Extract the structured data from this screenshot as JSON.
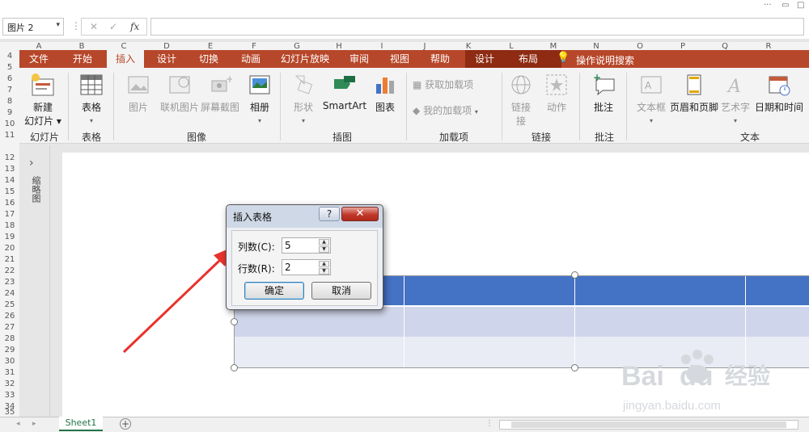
{
  "window": {
    "controls": [
      "···",
      "▭",
      "□"
    ]
  },
  "formula_bar": {
    "name_box": "图片 2",
    "cancel_icon": "✕",
    "enter_icon": "✓",
    "function_icon": "fx",
    "value": ""
  },
  "columns": [
    "A",
    "B",
    "C",
    "D",
    "E",
    "F",
    "G",
    "H",
    "I",
    "J",
    "K",
    "L",
    "M",
    "N",
    "O",
    "P",
    "Q",
    "R"
  ],
  "rows": [
    "4",
    "5",
    "6",
    "7",
    "8",
    "9",
    "10",
    "11",
    "12",
    "13",
    "14",
    "15",
    "16",
    "17",
    "18",
    "19",
    "20",
    "21",
    "22",
    "23",
    "24",
    "25",
    "26",
    "27",
    "28",
    "29",
    "30",
    "31",
    "32",
    "33",
    "34",
    "35"
  ],
  "ribbon_tabs": [
    "文件",
    "开始",
    "插入",
    "设计",
    "切换",
    "动画",
    "幻灯片放映",
    "审阅",
    "视图",
    "帮助",
    "设计",
    "布局"
  ],
  "active_tab": "插入",
  "tell_me": "操作说明搜索",
  "ribbon": {
    "new_slide": [
      "新建",
      "幻灯片 ▾"
    ],
    "table": "表格",
    "picture": "图片",
    "online_picture": "联机图片",
    "screenshot": "屏幕截图",
    "album": "相册",
    "shape": "形状",
    "smartart": "SmartArt",
    "chart": "图表",
    "get_addins": "获取加载项",
    "my_addins": "我的加载项",
    "link": "链接",
    "link_suffix": "接",
    "action": "动作",
    "comment": "批注",
    "textbox": "文本框",
    "header_footer": "页眉和页脚",
    "wordart": "艺术字",
    "datetime": "日期和时间",
    "groups": [
      "幻灯片",
      "表格",
      "图像",
      "插图",
      "加载项",
      "链接",
      "批注",
      "文本"
    ]
  },
  "side_panel": {
    "label": "缩略图"
  },
  "dialog": {
    "title": "插入表格",
    "help": "?",
    "close": "✕",
    "columns_label": "列数(C):",
    "columns_value": "5",
    "rows_label": "行数(R):",
    "rows_value": "2",
    "ok": "确定",
    "cancel": "取消"
  },
  "sheet_tab": "Sheet1",
  "watermark": {
    "brand": "Bai",
    "brand2": "du",
    "cn": "经验",
    "url": "jingyan.baidu.com"
  },
  "colors": {
    "ribbon_red": "#b7472a",
    "tool_tab": "#8e2b12",
    "table_header": "#4472c4",
    "table_row1": "#cfd5ea",
    "table_row2": "#e9ebf5",
    "arrow": "#e8322c"
  }
}
